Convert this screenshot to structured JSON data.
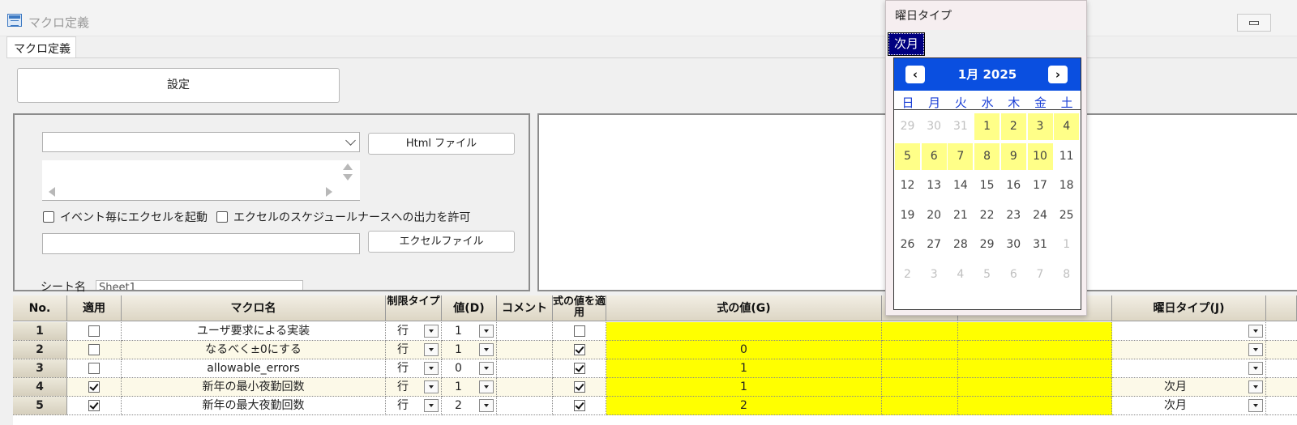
{
  "window": {
    "title": "マクロ定義"
  },
  "tabs": [
    {
      "label": "マクロ定義"
    }
  ],
  "toolbar": {
    "settings_label": "設定"
  },
  "form": {
    "html_button": "Html ファイル",
    "excel_button": "エクセルファイル",
    "checkbox1": {
      "label": "イベント毎にエクセルを起動",
      "checked": false
    },
    "checkbox2": {
      "label": "エクセルのスケジュールナースへの出力を許可",
      "checked": false
    },
    "sheet_label": "シート名",
    "sheet_value": "Sheet1"
  },
  "grid": {
    "headers": {
      "no": "No.",
      "apply": "適用",
      "macro_name": "マクロ名",
      "limit_type": "制限タイプ",
      "value_d": "値(D)",
      "comment": "コメント",
      "apply_formula": "式の値を適用",
      "formula_value": "式の値(G)",
      "weekday_type": "曜日タイプ(J)"
    },
    "rows": [
      {
        "no": "1",
        "apply": false,
        "name": "ユーザ要求による実装",
        "type": "行",
        "value": "1",
        "apply_formula": false,
        "formula": "",
        "weekday": ""
      },
      {
        "no": "2",
        "apply": false,
        "name": "なるべく±0にする",
        "type": "行",
        "value": "1",
        "apply_formula": true,
        "formula": "0",
        "weekday": ""
      },
      {
        "no": "3",
        "apply": false,
        "name": "allowable_errors",
        "type": "行",
        "value": "0",
        "apply_formula": true,
        "formula": "1",
        "weekday": ""
      },
      {
        "no": "4",
        "apply": true,
        "name": "新年の最小夜勤回数",
        "type": "行",
        "value": "1",
        "apply_formula": true,
        "formula": "1",
        "weekday": "次月"
      },
      {
        "no": "5",
        "apply": true,
        "name": "新年の最大夜勤回数",
        "type": "行",
        "value": "2",
        "apply_formula": true,
        "formula": "2",
        "weekday": "次月"
      }
    ]
  },
  "popup": {
    "title": "曜日タイプ",
    "selected_value": "次月",
    "calendar": {
      "title": "1月 2025",
      "prev": "‹",
      "next": "›",
      "weekdays": [
        "日",
        "月",
        "火",
        "水",
        "木",
        "金",
        "土"
      ],
      "days": [
        [
          "29",
          "30",
          "31",
          "1",
          "2",
          "3",
          "4"
        ],
        [
          "5",
          "6",
          "7",
          "8",
          "9",
          "10",
          "11"
        ],
        [
          "12",
          "13",
          "14",
          "15",
          "16",
          "17",
          "18"
        ],
        [
          "19",
          "20",
          "21",
          "22",
          "23",
          "24",
          "25"
        ],
        [
          "26",
          "27",
          "28",
          "29",
          "30",
          "31",
          "1"
        ],
        [
          "2",
          "3",
          "4",
          "5",
          "6",
          "7",
          "8"
        ]
      ]
    }
  },
  "colors": {
    "formula_fill": "#ffff00",
    "calendar_header": "#0a4fe0",
    "highlight_day": "#ffff88"
  }
}
